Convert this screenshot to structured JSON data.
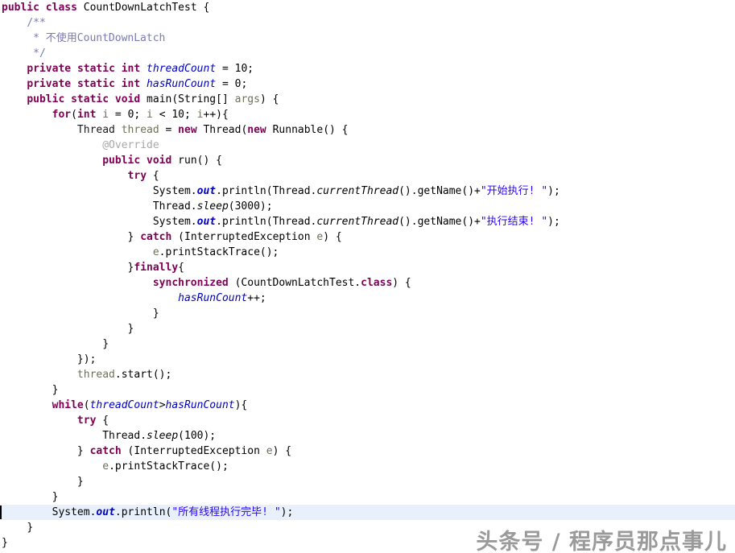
{
  "editor": {
    "file_name": "CountDownLatchTest.java",
    "language": "java",
    "background_color": "#ffffff",
    "current_line_highlight_color": "#e8f0fb",
    "caret_line_index": 33,
    "colors": {
      "keyword": "#7f0055",
      "comment": "#7a7ab4",
      "string": "#2a00ff",
      "field": "#0000c0",
      "static_field": "#0000c0",
      "local_variable": "#6f6f5a",
      "annotation": "#a8a8a8",
      "plain": "#000000"
    }
  },
  "watermark": {
    "text": "头条号 / 程序员那点事儿",
    "color": "#9a9a9a"
  },
  "code": {
    "lines": [
      {
        "n": 1,
        "indent": 0,
        "tokens": [
          {
            "t": "public",
            "c": "keyword"
          },
          {
            "t": " ",
            "c": "plain"
          },
          {
            "t": "class",
            "c": "keyword"
          },
          {
            "t": " CountDownLatchTest {",
            "c": "plain"
          }
        ]
      },
      {
        "n": 2,
        "indent": 1,
        "tokens": [
          {
            "t": "/**",
            "c": "comment"
          }
        ]
      },
      {
        "n": 3,
        "indent": 1,
        "tokens": [
          {
            "t": " * 不使用CountDownLatch",
            "c": "comment"
          }
        ]
      },
      {
        "n": 4,
        "indent": 1,
        "tokens": [
          {
            "t": " */",
            "c": "comment"
          }
        ]
      },
      {
        "n": 5,
        "indent": 1,
        "tokens": [
          {
            "t": "private",
            "c": "keyword"
          },
          {
            "t": " ",
            "c": "plain"
          },
          {
            "t": "static",
            "c": "keyword"
          },
          {
            "t": " ",
            "c": "plain"
          },
          {
            "t": "int",
            "c": "keyword"
          },
          {
            "t": " ",
            "c": "plain"
          },
          {
            "t": "threadCount",
            "c": "field"
          },
          {
            "t": " = ",
            "c": "plain"
          },
          {
            "t": "10",
            "c": "num"
          },
          {
            "t": ";",
            "c": "plain"
          }
        ]
      },
      {
        "n": 6,
        "indent": 1,
        "tokens": [
          {
            "t": "private",
            "c": "keyword"
          },
          {
            "t": " ",
            "c": "plain"
          },
          {
            "t": "static",
            "c": "keyword"
          },
          {
            "t": " ",
            "c": "plain"
          },
          {
            "t": "int",
            "c": "keyword"
          },
          {
            "t": " ",
            "c": "plain"
          },
          {
            "t": "hasRunCount",
            "c": "field"
          },
          {
            "t": " = ",
            "c": "plain"
          },
          {
            "t": "0",
            "c": "num"
          },
          {
            "t": ";",
            "c": "plain"
          }
        ]
      },
      {
        "n": 7,
        "indent": 1,
        "tokens": [
          {
            "t": "public",
            "c": "keyword"
          },
          {
            "t": " ",
            "c": "plain"
          },
          {
            "t": "static",
            "c": "keyword"
          },
          {
            "t": " ",
            "c": "plain"
          },
          {
            "t": "void",
            "c": "keyword"
          },
          {
            "t": " main(String[] ",
            "c": "plain"
          },
          {
            "t": "args",
            "c": "local"
          },
          {
            "t": ") {",
            "c": "plain"
          }
        ]
      },
      {
        "n": 8,
        "indent": 2,
        "tokens": [
          {
            "t": "for",
            "c": "keyword"
          },
          {
            "t": "(",
            "c": "plain"
          },
          {
            "t": "int",
            "c": "keyword"
          },
          {
            "t": " ",
            "c": "plain"
          },
          {
            "t": "i",
            "c": "local"
          },
          {
            "t": " = ",
            "c": "plain"
          },
          {
            "t": "0",
            "c": "num"
          },
          {
            "t": "; ",
            "c": "plain"
          },
          {
            "t": "i",
            "c": "local"
          },
          {
            "t": " < ",
            "c": "plain"
          },
          {
            "t": "10",
            "c": "num"
          },
          {
            "t": "; ",
            "c": "plain"
          },
          {
            "t": "i",
            "c": "local"
          },
          {
            "t": "++){",
            "c": "plain"
          }
        ]
      },
      {
        "n": 9,
        "indent": 3,
        "tokens": [
          {
            "t": "Thread ",
            "c": "type"
          },
          {
            "t": "thread",
            "c": "local"
          },
          {
            "t": " = ",
            "c": "plain"
          },
          {
            "t": "new",
            "c": "keyword"
          },
          {
            "t": " Thread(",
            "c": "plain"
          },
          {
            "t": "new",
            "c": "keyword"
          },
          {
            "t": " Runnable() {",
            "c": "plain"
          }
        ]
      },
      {
        "n": 10,
        "indent": 4,
        "tokens": [
          {
            "t": "@Override",
            "c": "annot"
          }
        ]
      },
      {
        "n": 11,
        "indent": 4,
        "tokens": [
          {
            "t": "public",
            "c": "keyword"
          },
          {
            "t": " ",
            "c": "plain"
          },
          {
            "t": "void",
            "c": "keyword"
          },
          {
            "t": " run() {",
            "c": "plain"
          }
        ]
      },
      {
        "n": 12,
        "indent": 5,
        "tokens": [
          {
            "t": "try",
            "c": "keyword"
          },
          {
            "t": " {",
            "c": "plain"
          }
        ]
      },
      {
        "n": 13,
        "indent": 6,
        "tokens": [
          {
            "t": "System.",
            "c": "plain"
          },
          {
            "t": "out",
            "c": "staticfld"
          },
          {
            "t": ".println(Thread.",
            "c": "plain"
          },
          {
            "t": "currentThread",
            "c": "method"
          },
          {
            "t": "().getName()+",
            "c": "plain"
          },
          {
            "t": "\"开始执行! \"",
            "c": "string"
          },
          {
            "t": ");",
            "c": "plain"
          }
        ]
      },
      {
        "n": 14,
        "indent": 6,
        "tokens": [
          {
            "t": "Thread.",
            "c": "plain"
          },
          {
            "t": "sleep",
            "c": "method"
          },
          {
            "t": "(",
            "c": "plain"
          },
          {
            "t": "3000",
            "c": "num"
          },
          {
            "t": ");",
            "c": "plain"
          }
        ]
      },
      {
        "n": 15,
        "indent": 6,
        "tokens": [
          {
            "t": "System.",
            "c": "plain"
          },
          {
            "t": "out",
            "c": "staticfld"
          },
          {
            "t": ".println(Thread.",
            "c": "plain"
          },
          {
            "t": "currentThread",
            "c": "method"
          },
          {
            "t": "().getName()+",
            "c": "plain"
          },
          {
            "t": "\"执行结束! \"",
            "c": "string"
          },
          {
            "t": ");",
            "c": "plain"
          }
        ]
      },
      {
        "n": 16,
        "indent": 5,
        "tokens": [
          {
            "t": "} ",
            "c": "plain"
          },
          {
            "t": "catch",
            "c": "keyword"
          },
          {
            "t": " (InterruptedException ",
            "c": "plain"
          },
          {
            "t": "e",
            "c": "local"
          },
          {
            "t": ") {",
            "c": "plain"
          }
        ]
      },
      {
        "n": 17,
        "indent": 6,
        "tokens": [
          {
            "t": "e",
            "c": "local"
          },
          {
            "t": ".printStackTrace();",
            "c": "plain"
          }
        ]
      },
      {
        "n": 18,
        "indent": 5,
        "tokens": [
          {
            "t": "}",
            "c": "plain"
          },
          {
            "t": "finally",
            "c": "keyword"
          },
          {
            "t": "{",
            "c": "plain"
          }
        ]
      },
      {
        "n": 19,
        "indent": 6,
        "tokens": [
          {
            "t": "synchronized",
            "c": "keyword"
          },
          {
            "t": " (CountDownLatchTest.",
            "c": "plain"
          },
          {
            "t": "class",
            "c": "keyword"
          },
          {
            "t": ") {",
            "c": "plain"
          }
        ]
      },
      {
        "n": 20,
        "indent": 7,
        "tokens": [
          {
            "t": "hasRunCount",
            "c": "field"
          },
          {
            "t": "++;",
            "c": "plain"
          }
        ]
      },
      {
        "n": 21,
        "indent": 6,
        "tokens": [
          {
            "t": "}",
            "c": "plain"
          }
        ]
      },
      {
        "n": 22,
        "indent": 5,
        "tokens": [
          {
            "t": "}",
            "c": "plain"
          }
        ]
      },
      {
        "n": 23,
        "indent": 4,
        "tokens": [
          {
            "t": "}",
            "c": "plain"
          }
        ]
      },
      {
        "n": 24,
        "indent": 3,
        "tokens": [
          {
            "t": "});",
            "c": "plain"
          }
        ]
      },
      {
        "n": 25,
        "indent": 3,
        "tokens": [
          {
            "t": "thread",
            "c": "local"
          },
          {
            "t": ".start();",
            "c": "plain"
          }
        ]
      },
      {
        "n": 26,
        "indent": 2,
        "tokens": [
          {
            "t": "}",
            "c": "plain"
          }
        ]
      },
      {
        "n": 27,
        "indent": 2,
        "tokens": [
          {
            "t": "while",
            "c": "keyword"
          },
          {
            "t": "(",
            "c": "plain"
          },
          {
            "t": "threadCount",
            "c": "field"
          },
          {
            "t": ">",
            "c": "plain"
          },
          {
            "t": "hasRunCount",
            "c": "field"
          },
          {
            "t": "){",
            "c": "plain"
          }
        ]
      },
      {
        "n": 28,
        "indent": 3,
        "tokens": [
          {
            "t": "try",
            "c": "keyword"
          },
          {
            "t": " {",
            "c": "plain"
          }
        ]
      },
      {
        "n": 29,
        "indent": 4,
        "tokens": [
          {
            "t": "Thread.",
            "c": "plain"
          },
          {
            "t": "sleep",
            "c": "method"
          },
          {
            "t": "(",
            "c": "plain"
          },
          {
            "t": "100",
            "c": "num"
          },
          {
            "t": ");",
            "c": "plain"
          }
        ]
      },
      {
        "n": 30,
        "indent": 3,
        "tokens": [
          {
            "t": "} ",
            "c": "plain"
          },
          {
            "t": "catch",
            "c": "keyword"
          },
          {
            "t": " (InterruptedException ",
            "c": "plain"
          },
          {
            "t": "e",
            "c": "local"
          },
          {
            "t": ") {",
            "c": "plain"
          }
        ]
      },
      {
        "n": 31,
        "indent": 4,
        "tokens": [
          {
            "t": "e",
            "c": "local"
          },
          {
            "t": ".printStackTrace();",
            "c": "plain"
          }
        ]
      },
      {
        "n": 32,
        "indent": 3,
        "tokens": [
          {
            "t": "}",
            "c": "plain"
          }
        ]
      },
      {
        "n": 33,
        "indent": 2,
        "tokens": [
          {
            "t": "}",
            "c": "plain"
          }
        ]
      },
      {
        "n": 34,
        "indent": 2,
        "tokens": [
          {
            "t": "System.",
            "c": "plain"
          },
          {
            "t": "out",
            "c": "staticfld"
          },
          {
            "t": ".println(",
            "c": "plain"
          },
          {
            "t": "\"所有线程执行完毕! \"",
            "c": "string"
          },
          {
            "t": ");",
            "c": "plain"
          }
        ]
      },
      {
        "n": 35,
        "indent": 1,
        "tokens": [
          {
            "t": "}",
            "c": "plain"
          }
        ]
      },
      {
        "n": 36,
        "indent": 0,
        "tokens": [
          {
            "t": "}",
            "c": "plain"
          }
        ]
      }
    ]
  }
}
